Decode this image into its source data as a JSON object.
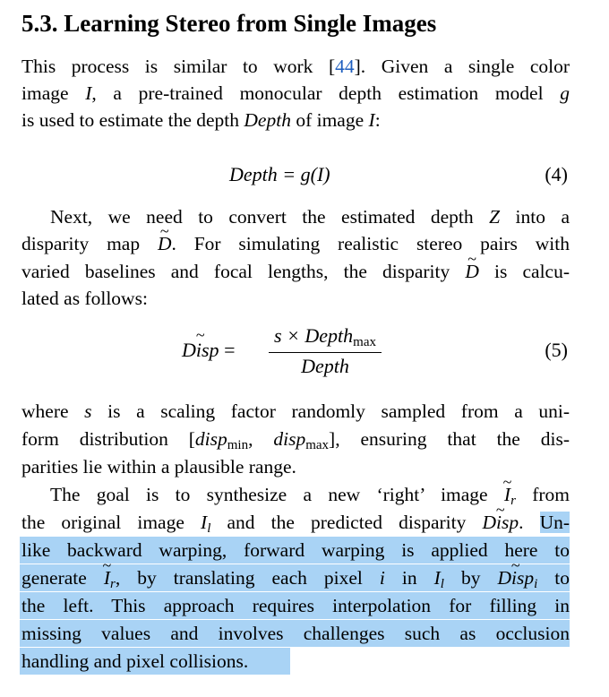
{
  "heading": "5.3. Learning Stereo from Single Images",
  "p1": {
    "l1a": "This process is similar to work [",
    "cite": "44",
    "l1b": "].  Given a single color",
    "l2a": "image ",
    "l2v": "I",
    "l2b": ", a pre-trained monocular depth estimation model ",
    "l2g": "g",
    "l3a": "is used to estimate the depth ",
    "l3v": "Depth",
    "l3b": " of image ",
    "l3c": "I",
    "l3d": ":"
  },
  "eq4": {
    "lhs": "Depth",
    "rhs": " = g(I)",
    "num": "(4)"
  },
  "p2": {
    "l1a": "Next, we need to convert the estimated depth ",
    "l1v": "Z",
    "l1b": " into a",
    "l2a": "disparity map ",
    "l2v": "D",
    "l2b": ". For simulating realistic stereo pairs with",
    "l3a": "varied baselines and focal lengths, the disparity ",
    "l3v": "D",
    "l3b": " is calcu-",
    "l4": "lated as follows:"
  },
  "eq5": {
    "lhs": "Disp",
    "eq": " =",
    "num_s": "s × Depth",
    "num_sub": "max",
    "den": "Depth",
    "number": "(5)"
  },
  "p3": {
    "l1a": "where ",
    "l1v": "s",
    "l1b": " is a scaling factor randomly sampled from a uni-",
    "l2a": "form distribution [",
    "l2v1": "disp",
    "l2s1": "min",
    "l2c": ", ",
    "l2v2": "disp",
    "l2s2": "max",
    "l2b": "], ensuring that the dis-",
    "l3": "parities lie within a plausible range."
  },
  "p4": {
    "l1a": "The goal is to synthesize a new ‘right’ image ",
    "l1v": "I",
    "l1s": "r",
    "l1b": " from",
    "l2a": "the original image ",
    "l2v": "I",
    "l2s": "l",
    "l2b": " and the predicted disparity ",
    "l2d": "Disp",
    "l2c": ". ",
    "l2h": "Un-",
    "l3": "like backward warping, forward warping is applied here to",
    "l4a": "generate ",
    "l4v": "I",
    "l4s": "r",
    "l4b": ", by translating each pixel ",
    "l4i": "i",
    "l4c": " in ",
    "l4v2": "I",
    "l4s2": "l",
    "l4d": " by ",
    "l4e": "Disp",
    "l4es": "i",
    "l4f": " to",
    "l5": "the left.  This approach requires interpolation for filling in",
    "l6": "missing values and involves challenges such as occlusion",
    "l7": "handling and pixel collisions."
  },
  "colors": {
    "highlight": "#a9d3f5",
    "citation": "#1f5fbf"
  }
}
